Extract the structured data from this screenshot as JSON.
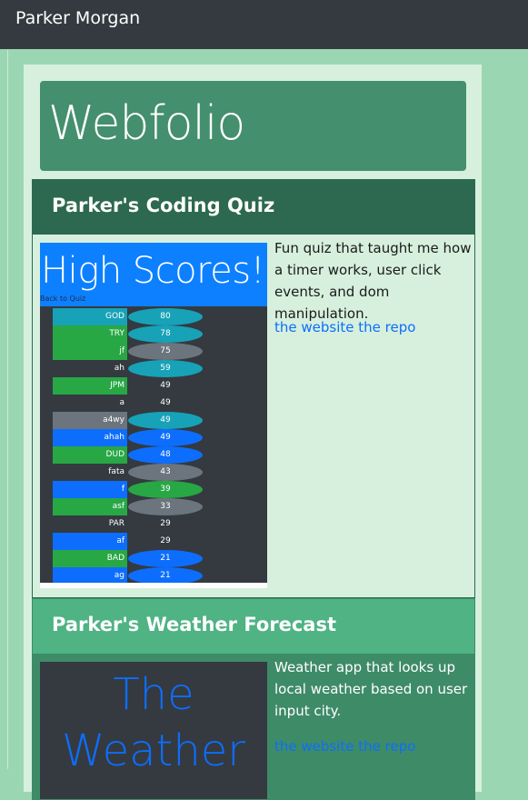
{
  "navbar": {
    "brand": "Parker Morgan"
  },
  "jumbotron": {
    "title": "Webfolio"
  },
  "projects": [
    {
      "title": "Parker's Coding Quiz",
      "description": "Fun quiz that taught me how a timer works, user click events, and dom manipulation.",
      "link_website": "the website",
      "link_repo": "the repo",
      "screenshot": {
        "banner": "High Scores!",
        "back_link": "Back to Quiz",
        "scores": [
          {
            "name": "GOD",
            "score": "80",
            "name_color": "#17a2b8",
            "pill_color": "#17a2b8"
          },
          {
            "name": "TRY",
            "score": "78",
            "name_color": "#28a745",
            "pill_color": "#17a2b8"
          },
          {
            "name": "jf",
            "score": "75",
            "name_color": "#28a745",
            "pill_color": "#6c757d"
          },
          {
            "name": "ah",
            "score": "59",
            "name_color": "#343a40",
            "pill_color": "#17a2b8"
          },
          {
            "name": "JPM",
            "score": "49",
            "name_color": "#28a745",
            "pill_color": "#343a40"
          },
          {
            "name": "a",
            "score": "49",
            "name_color": "#343a40",
            "pill_color": "#343a40"
          },
          {
            "name": "a4wy",
            "score": "49",
            "name_color": "#6c757d",
            "pill_color": "#17a2b8"
          },
          {
            "name": "ahah",
            "score": "49",
            "name_color": "#0d6efd",
            "pill_color": "#0d6efd"
          },
          {
            "name": "DUD",
            "score": "48",
            "name_color": "#28a745",
            "pill_color": "#0d6efd"
          },
          {
            "name": "fata",
            "score": "43",
            "name_color": "#343a40",
            "pill_color": "#6c757d"
          },
          {
            "name": "f",
            "score": "39",
            "name_color": "#0d6efd",
            "pill_color": "#28a745"
          },
          {
            "name": "asf",
            "score": "33",
            "name_color": "#28a745",
            "pill_color": "#6c757d"
          },
          {
            "name": "PAR",
            "score": "29",
            "name_color": "#343a40",
            "pill_color": "#343a40"
          },
          {
            "name": "af",
            "score": "29",
            "name_color": "#0d6efd",
            "pill_color": "#343a40"
          },
          {
            "name": "BAD",
            "score": "21",
            "name_color": "#28a745",
            "pill_color": "#0d6efd"
          },
          {
            "name": "ag",
            "score": "21",
            "name_color": "#0d6efd",
            "pill_color": "#0d6efd"
          }
        ]
      }
    },
    {
      "title": "Parker's Weather Forecast",
      "description": "Weather app that looks up local weather based on user input city.",
      "link_website": "the website",
      "link_repo": "the repo",
      "screenshot": {
        "banner": "The Weather"
      }
    }
  ]
}
